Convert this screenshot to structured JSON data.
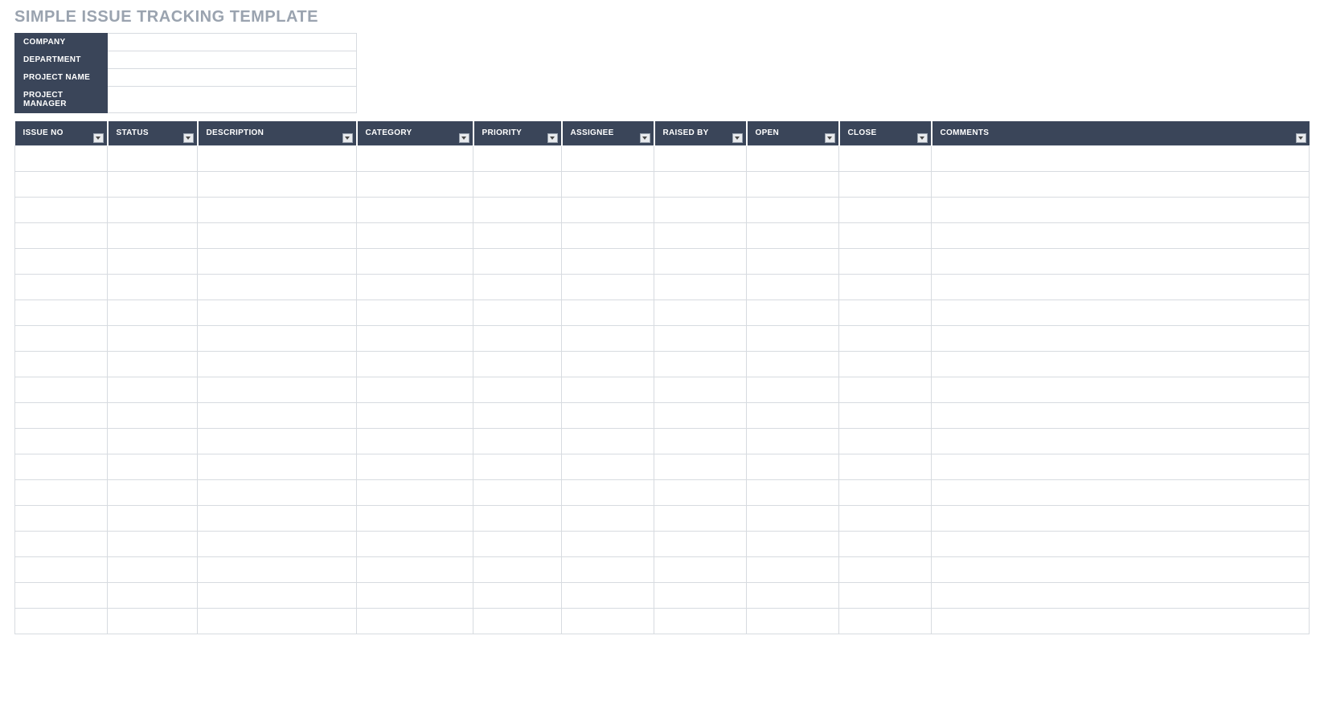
{
  "title": "SIMPLE ISSUE TRACKING TEMPLATE",
  "info_fields": [
    {
      "label": "COMPANY",
      "value": ""
    },
    {
      "label": "DEPARTMENT",
      "value": ""
    },
    {
      "label": "PROJECT NAME",
      "value": ""
    },
    {
      "label": "PROJECT MANAGER",
      "value": ""
    }
  ],
  "columns": [
    {
      "label": "ISSUE NO",
      "class": "col-issue-no"
    },
    {
      "label": "STATUS",
      "class": "col-status"
    },
    {
      "label": "DESCRIPTION",
      "class": "col-description"
    },
    {
      "label": "CATEGORY",
      "class": "col-category"
    },
    {
      "label": "PRIORITY",
      "class": "col-priority"
    },
    {
      "label": "ASSIGNEE",
      "class": "col-assignee"
    },
    {
      "label": "RAISED BY",
      "class": "col-raised-by"
    },
    {
      "label": "OPEN",
      "class": "col-open"
    },
    {
      "label": "CLOSE",
      "class": "col-close"
    },
    {
      "label": "COMMENTS",
      "class": "col-comments"
    }
  ],
  "rows": [
    [
      "",
      "",
      "",
      "",
      "",
      "",
      "",
      "",
      "",
      ""
    ],
    [
      "",
      "",
      "",
      "",
      "",
      "",
      "",
      "",
      "",
      ""
    ],
    [
      "",
      "",
      "",
      "",
      "",
      "",
      "",
      "",
      "",
      ""
    ],
    [
      "",
      "",
      "",
      "",
      "",
      "",
      "",
      "",
      "",
      ""
    ],
    [
      "",
      "",
      "",
      "",
      "",
      "",
      "",
      "",
      "",
      ""
    ],
    [
      "",
      "",
      "",
      "",
      "",
      "",
      "",
      "",
      "",
      ""
    ],
    [
      "",
      "",
      "",
      "",
      "",
      "",
      "",
      "",
      "",
      ""
    ],
    [
      "",
      "",
      "",
      "",
      "",
      "",
      "",
      "",
      "",
      ""
    ],
    [
      "",
      "",
      "",
      "",
      "",
      "",
      "",
      "",
      "",
      ""
    ],
    [
      "",
      "",
      "",
      "",
      "",
      "",
      "",
      "",
      "",
      ""
    ],
    [
      "",
      "",
      "",
      "",
      "",
      "",
      "",
      "",
      "",
      ""
    ],
    [
      "",
      "",
      "",
      "",
      "",
      "",
      "",
      "",
      "",
      ""
    ],
    [
      "",
      "",
      "",
      "",
      "",
      "",
      "",
      "",
      "",
      ""
    ],
    [
      "",
      "",
      "",
      "",
      "",
      "",
      "",
      "",
      "",
      ""
    ],
    [
      "",
      "",
      "",
      "",
      "",
      "",
      "",
      "",
      "",
      ""
    ],
    [
      "",
      "",
      "",
      "",
      "",
      "",
      "",
      "",
      "",
      ""
    ],
    [
      "",
      "",
      "",
      "",
      "",
      "",
      "",
      "",
      "",
      ""
    ],
    [
      "",
      "",
      "",
      "",
      "",
      "",
      "",
      "",
      "",
      ""
    ],
    [
      "",
      "",
      "",
      "",
      "",
      "",
      "",
      "",
      "",
      ""
    ]
  ]
}
